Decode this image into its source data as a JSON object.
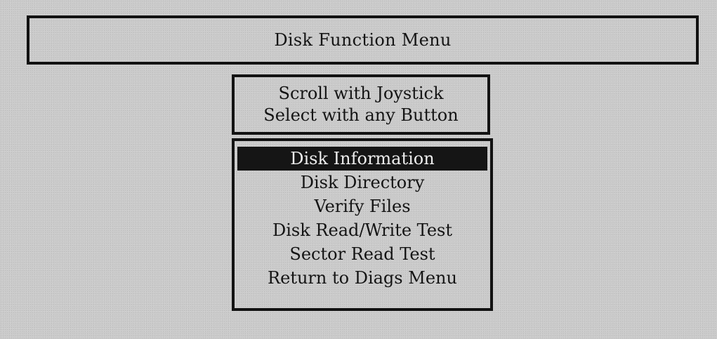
{
  "header": {
    "title": "Disk Function Menu"
  },
  "instructions": {
    "line1": "Scroll with Joystick",
    "line2": "Select with any Button"
  },
  "menu": {
    "selected_index": 0,
    "items": [
      {
        "label": "Disk Information"
      },
      {
        "label": "Disk Directory"
      },
      {
        "label": "Verify Files"
      },
      {
        "label": "Disk Read/Write Test"
      },
      {
        "label": "Sector Read Test"
      },
      {
        "label": "Return to Diags Menu"
      }
    ]
  }
}
